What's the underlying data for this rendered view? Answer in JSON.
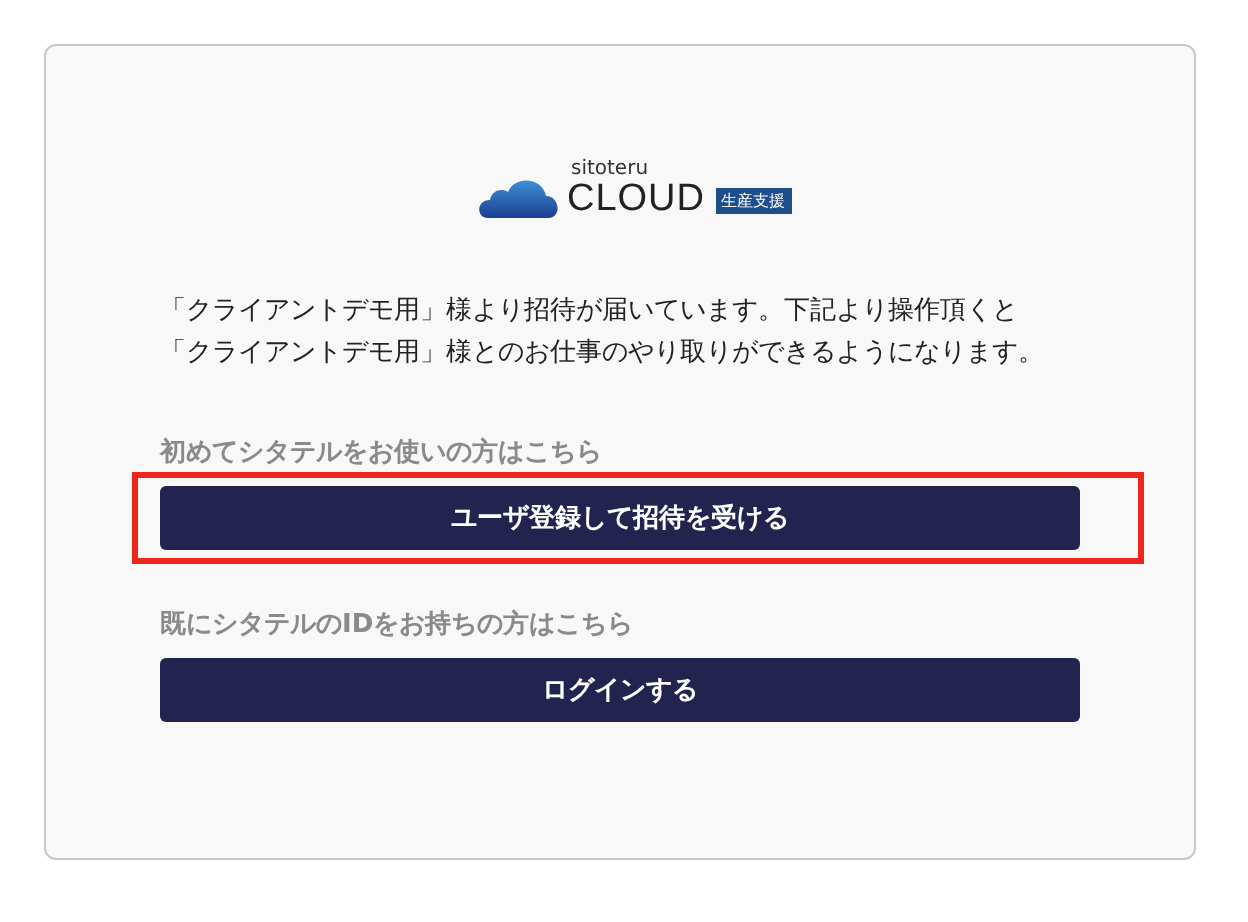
{
  "logo": {
    "small_text": "sitoteru",
    "main_text": "CLOUD",
    "badge": "生産支援"
  },
  "message": "「クライアントデモ用」様より招待が届いています。下記より操作頂くと「クライアントデモ用」様とのお仕事のやり取りができるようになります。",
  "sections": [
    {
      "label": "初めてシタテルをお使いの方はこちら",
      "button": "ユーザ登録して招待を受ける",
      "highlighted": true
    },
    {
      "label": "既にシタテルのIDをお持ちの方はこちら",
      "button": "ログインする",
      "highlighted": false
    }
  ]
}
